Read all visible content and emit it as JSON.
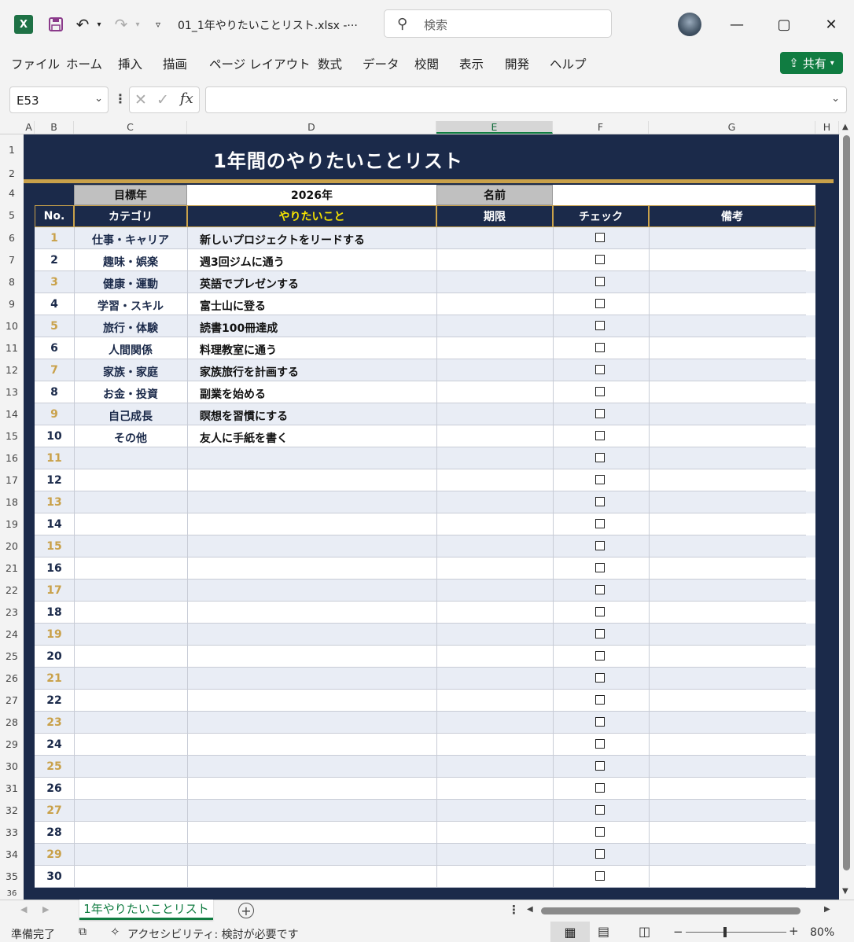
{
  "window": {
    "excel_logo": "X",
    "filename": "01_1年やりたいことリスト.xlsx  -···",
    "search_placeholder": "検索"
  },
  "menu": [
    "ファイル",
    "ホーム",
    "挿入",
    "描画",
    "ページ レイアウト",
    "数式",
    "データ",
    "校閲",
    "表示",
    "開発",
    "ヘルプ"
  ],
  "share_label": "共有",
  "formula_bar": {
    "name_box": "E53",
    "fx": "fx",
    "formula": ""
  },
  "columns": [
    "A",
    "B",
    "C",
    "D",
    "E",
    "F",
    "G",
    "H"
  ],
  "rows": [
    "1",
    "2",
    "4",
    "5",
    "6",
    "7",
    "8",
    "9",
    "10",
    "11",
    "12",
    "13",
    "14",
    "15",
    "16",
    "17",
    "18",
    "19",
    "20",
    "21",
    "22",
    "23",
    "24",
    "25",
    "26",
    "27",
    "28",
    "29",
    "30",
    "31",
    "32",
    "33",
    "34",
    "35",
    "36"
  ],
  "sheet": {
    "title": "1年間のやりたいことリスト",
    "target_year_label": "目標年",
    "target_year_value": "2026年",
    "name_label": "名前",
    "name_value": "",
    "headers": {
      "no": "No.",
      "category": "カテゴリ",
      "todo": "やりたいこと",
      "deadline": "期限",
      "check": "チェック",
      "note": "備考"
    },
    "items": [
      {
        "no": "1",
        "category": "仕事・キャリア",
        "todo": "新しいプロジェクトをリードする"
      },
      {
        "no": "2",
        "category": "趣味・娯楽",
        "todo": "週3回ジムに通う"
      },
      {
        "no": "3",
        "category": "健康・運動",
        "todo": "英語でプレゼンする"
      },
      {
        "no": "4",
        "category": "学習・スキル",
        "todo": "富士山に登る"
      },
      {
        "no": "5",
        "category": "旅行・体験",
        "todo": "読書100冊達成"
      },
      {
        "no": "6",
        "category": "人間関係",
        "todo": "料理教室に通う"
      },
      {
        "no": "7",
        "category": "家族・家庭",
        "todo": "家族旅行を計画する"
      },
      {
        "no": "8",
        "category": "お金・投資",
        "todo": "副業を始める"
      },
      {
        "no": "9",
        "category": "自己成長",
        "todo": "瞑想を習慣にする"
      },
      {
        "no": "10",
        "category": "その他",
        "todo": "友人に手紙を書く"
      },
      {
        "no": "11",
        "category": "",
        "todo": ""
      },
      {
        "no": "12",
        "category": "",
        "todo": ""
      },
      {
        "no": "13",
        "category": "",
        "todo": ""
      },
      {
        "no": "14",
        "category": "",
        "todo": ""
      },
      {
        "no": "15",
        "category": "",
        "todo": ""
      },
      {
        "no": "16",
        "category": "",
        "todo": ""
      },
      {
        "no": "17",
        "category": "",
        "todo": ""
      },
      {
        "no": "18",
        "category": "",
        "todo": ""
      },
      {
        "no": "19",
        "category": "",
        "todo": ""
      },
      {
        "no": "20",
        "category": "",
        "todo": ""
      },
      {
        "no": "21",
        "category": "",
        "todo": ""
      },
      {
        "no": "22",
        "category": "",
        "todo": ""
      },
      {
        "no": "23",
        "category": "",
        "todo": ""
      },
      {
        "no": "24",
        "category": "",
        "todo": ""
      },
      {
        "no": "25",
        "category": "",
        "todo": ""
      },
      {
        "no": "26",
        "category": "",
        "todo": ""
      },
      {
        "no": "27",
        "category": "",
        "todo": ""
      },
      {
        "no": "28",
        "category": "",
        "todo": ""
      },
      {
        "no": "29",
        "category": "",
        "todo": ""
      },
      {
        "no": "30",
        "category": "",
        "todo": ""
      }
    ],
    "colors": {
      "navy": "#1b2a4a",
      "gold": "#c9a14a",
      "stripe": "#e9edf5",
      "yellow": "#f5e300"
    }
  },
  "sheet_tab": "1年やりたいことリスト",
  "status": {
    "ready": "準備完了",
    "accessibility": "アクセシビリティ: 検討が必要です",
    "zoom": "80%"
  }
}
